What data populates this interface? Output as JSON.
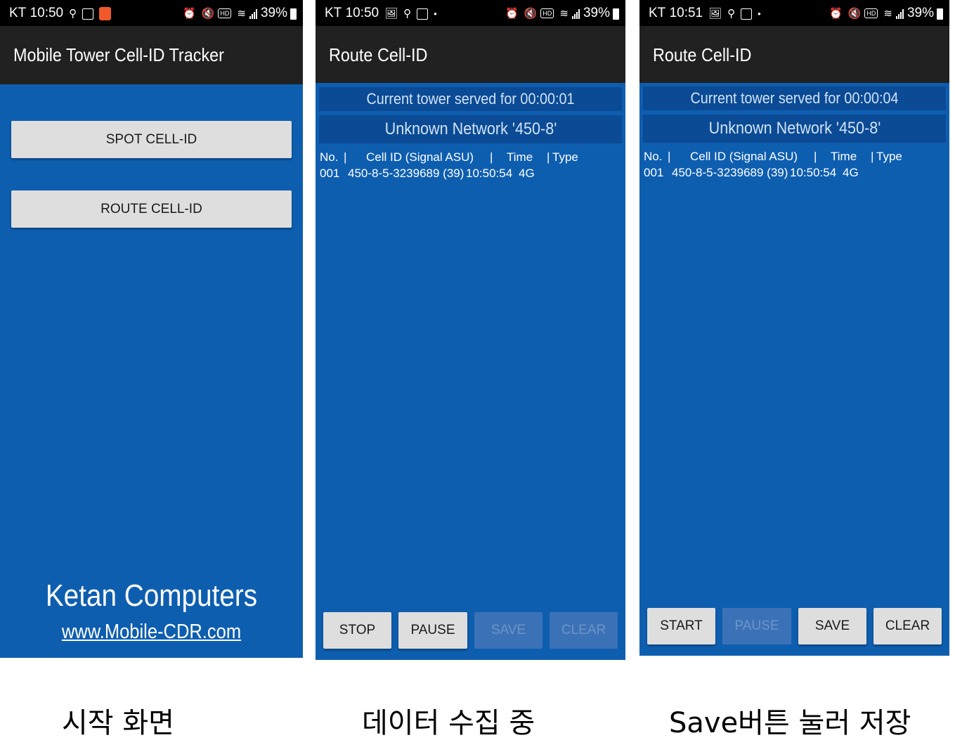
{
  "screens": [
    {
      "status": {
        "carrier": "KT",
        "time": "10:50",
        "battery": "39%",
        "hd": "HD"
      },
      "title": "Mobile Tower Cell-ID Tracker",
      "buttons": [
        "SPOT CELL-ID",
        "ROUTE CELL-ID"
      ],
      "brand": "Ketan Computers",
      "link": "www.Mobile-CDR.com"
    },
    {
      "status": {
        "carrier": "KT",
        "time": "10:50",
        "battery": "39%",
        "hd": "HD"
      },
      "title": "Route Cell-ID",
      "served": "Current tower served for 00:00:01",
      "network": "Unknown Network '450-8'",
      "columns": [
        "No.",
        "Cell ID (Signal ASU)",
        "Time",
        "Type"
      ],
      "rows": [
        {
          "no": "001",
          "cell": "450-8-5-3239689 (39)",
          "time": "10:50:54",
          "type": "4G"
        }
      ],
      "buttons": [
        {
          "label": "STOP",
          "enabled": true
        },
        {
          "label": "PAUSE",
          "enabled": true
        },
        {
          "label": "SAVE",
          "enabled": false
        },
        {
          "label": "CLEAR",
          "enabled": false
        }
      ]
    },
    {
      "status": {
        "carrier": "KT",
        "time": "10:51",
        "battery": "39%",
        "hd": "HD"
      },
      "title": "Route Cell-ID",
      "served": "Current tower served for 00:00:04",
      "network": "Unknown Network '450-8'",
      "columns": [
        "No.",
        "Cell ID (Signal ASU)",
        "Time",
        "Type"
      ],
      "rows": [
        {
          "no": "001",
          "cell": "450-8-5-3239689 (39)",
          "time": "10:50:54",
          "type": "4G"
        }
      ],
      "buttons": [
        {
          "label": "START",
          "enabled": true
        },
        {
          "label": "PAUSE",
          "enabled": false
        },
        {
          "label": "SAVE",
          "enabled": true
        },
        {
          "label": "CLEAR",
          "enabled": true
        }
      ]
    }
  ],
  "captions": [
    "시작 화면",
    "데이터 수집 중",
    "Save버튼 눌러 저장"
  ],
  "colors": {
    "app_blue": "#0e5eb0",
    "info_bar": "#0b4a94",
    "appbar": "#212121",
    "button": "#dedede",
    "button_disabled": "#3b72b7"
  }
}
